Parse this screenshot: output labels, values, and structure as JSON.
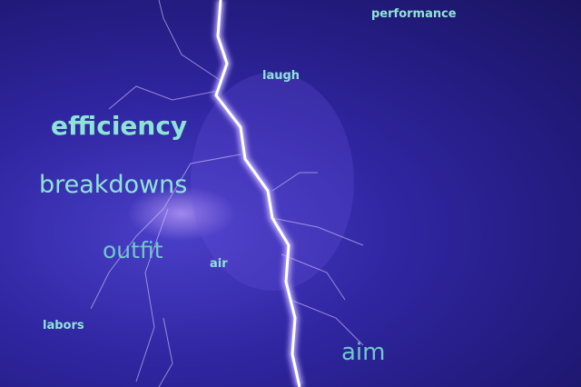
{
  "image": {
    "subject": "lightning-storm",
    "text_color": "#8fe3d6"
  },
  "words": [
    {
      "text": "performance"
    },
    {
      "text": "laugh"
    },
    {
      "text": "efficiency"
    },
    {
      "text": "breakdowns"
    },
    {
      "text": "outfit"
    },
    {
      "text": "air"
    },
    {
      "text": "labors"
    },
    {
      "text": "aim"
    }
  ]
}
